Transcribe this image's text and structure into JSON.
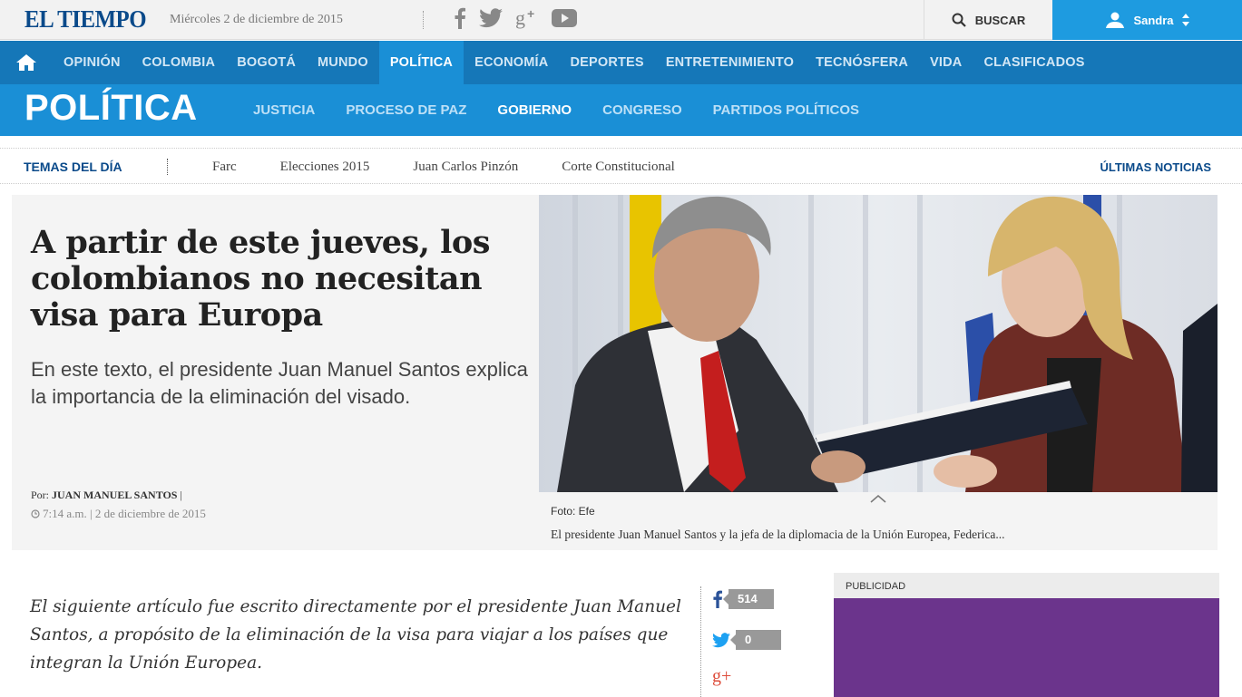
{
  "topbar": {
    "logo": "EL TIEMPO",
    "date": "Miércoles 2 de diciembre de 2015",
    "social_icons": [
      "facebook-icon",
      "twitter-icon",
      "google-plus-icon",
      "youtube-icon"
    ],
    "search_label": "BUSCAR",
    "user_name": "Sandra"
  },
  "main_nav": {
    "items": [
      "OPINIÓN",
      "COLOMBIA",
      "BOGOTÁ",
      "MUNDO",
      "POLÍTICA",
      "ECONOMÍA",
      "DEPORTES",
      "ENTRETENIMIENTO",
      "TECNÓSFERA",
      "VIDA",
      "CLASIFICADOS"
    ],
    "active": "POLÍTICA"
  },
  "section": {
    "title": "POLÍTICA",
    "subnav": [
      "JUSTICIA",
      "PROCESO DE PAZ",
      "GOBIERNO",
      "CONGRESO",
      "PARTIDOS POLÍTICOS"
    ],
    "active": "GOBIERNO"
  },
  "temas": {
    "label": "TEMAS DEL DÍA",
    "items": [
      "Farc",
      "Elecciones 2015",
      "Juan Carlos Pinzón",
      "Corte Constitucional"
    ],
    "ultimas": "ÚLTIMAS NOTICIAS"
  },
  "article": {
    "headline": "A partir de este jueves, los colombianos no necesitan visa para Europa",
    "lead": "En este texto, el presidente Juan Manuel Santos explica la importancia de la eliminación del visado.",
    "byline_prefix": "Por:",
    "author": "JUAN MANUEL SANTOS",
    "byline_suffix": "|",
    "time": "7:14 a.m. | 2 de diciembre de 2015",
    "photo_credit": "Foto: Efe",
    "caption": "El presidente Juan Manuel Santos y la jefa de la diplomacia de la Unión Europea, Federica...",
    "intro": "El siguiente artículo fue escrito directamente por el presidente Juan Manuel Santos, a propósito de la eliminación de la visa para viajar a los países que integran la Unión Europea."
  },
  "share": {
    "facebook_count": "514",
    "twitter_count": "0",
    "google_plus_label": "g+"
  },
  "ad": {
    "label": "PUBLICIDAD",
    "color": "#6b348c"
  },
  "colors": {
    "brand_dark": "#0a4a8a",
    "nav_blue": "#1577b8",
    "section_blue": "#1a8fd6",
    "user_blue": "#1e9be0"
  }
}
